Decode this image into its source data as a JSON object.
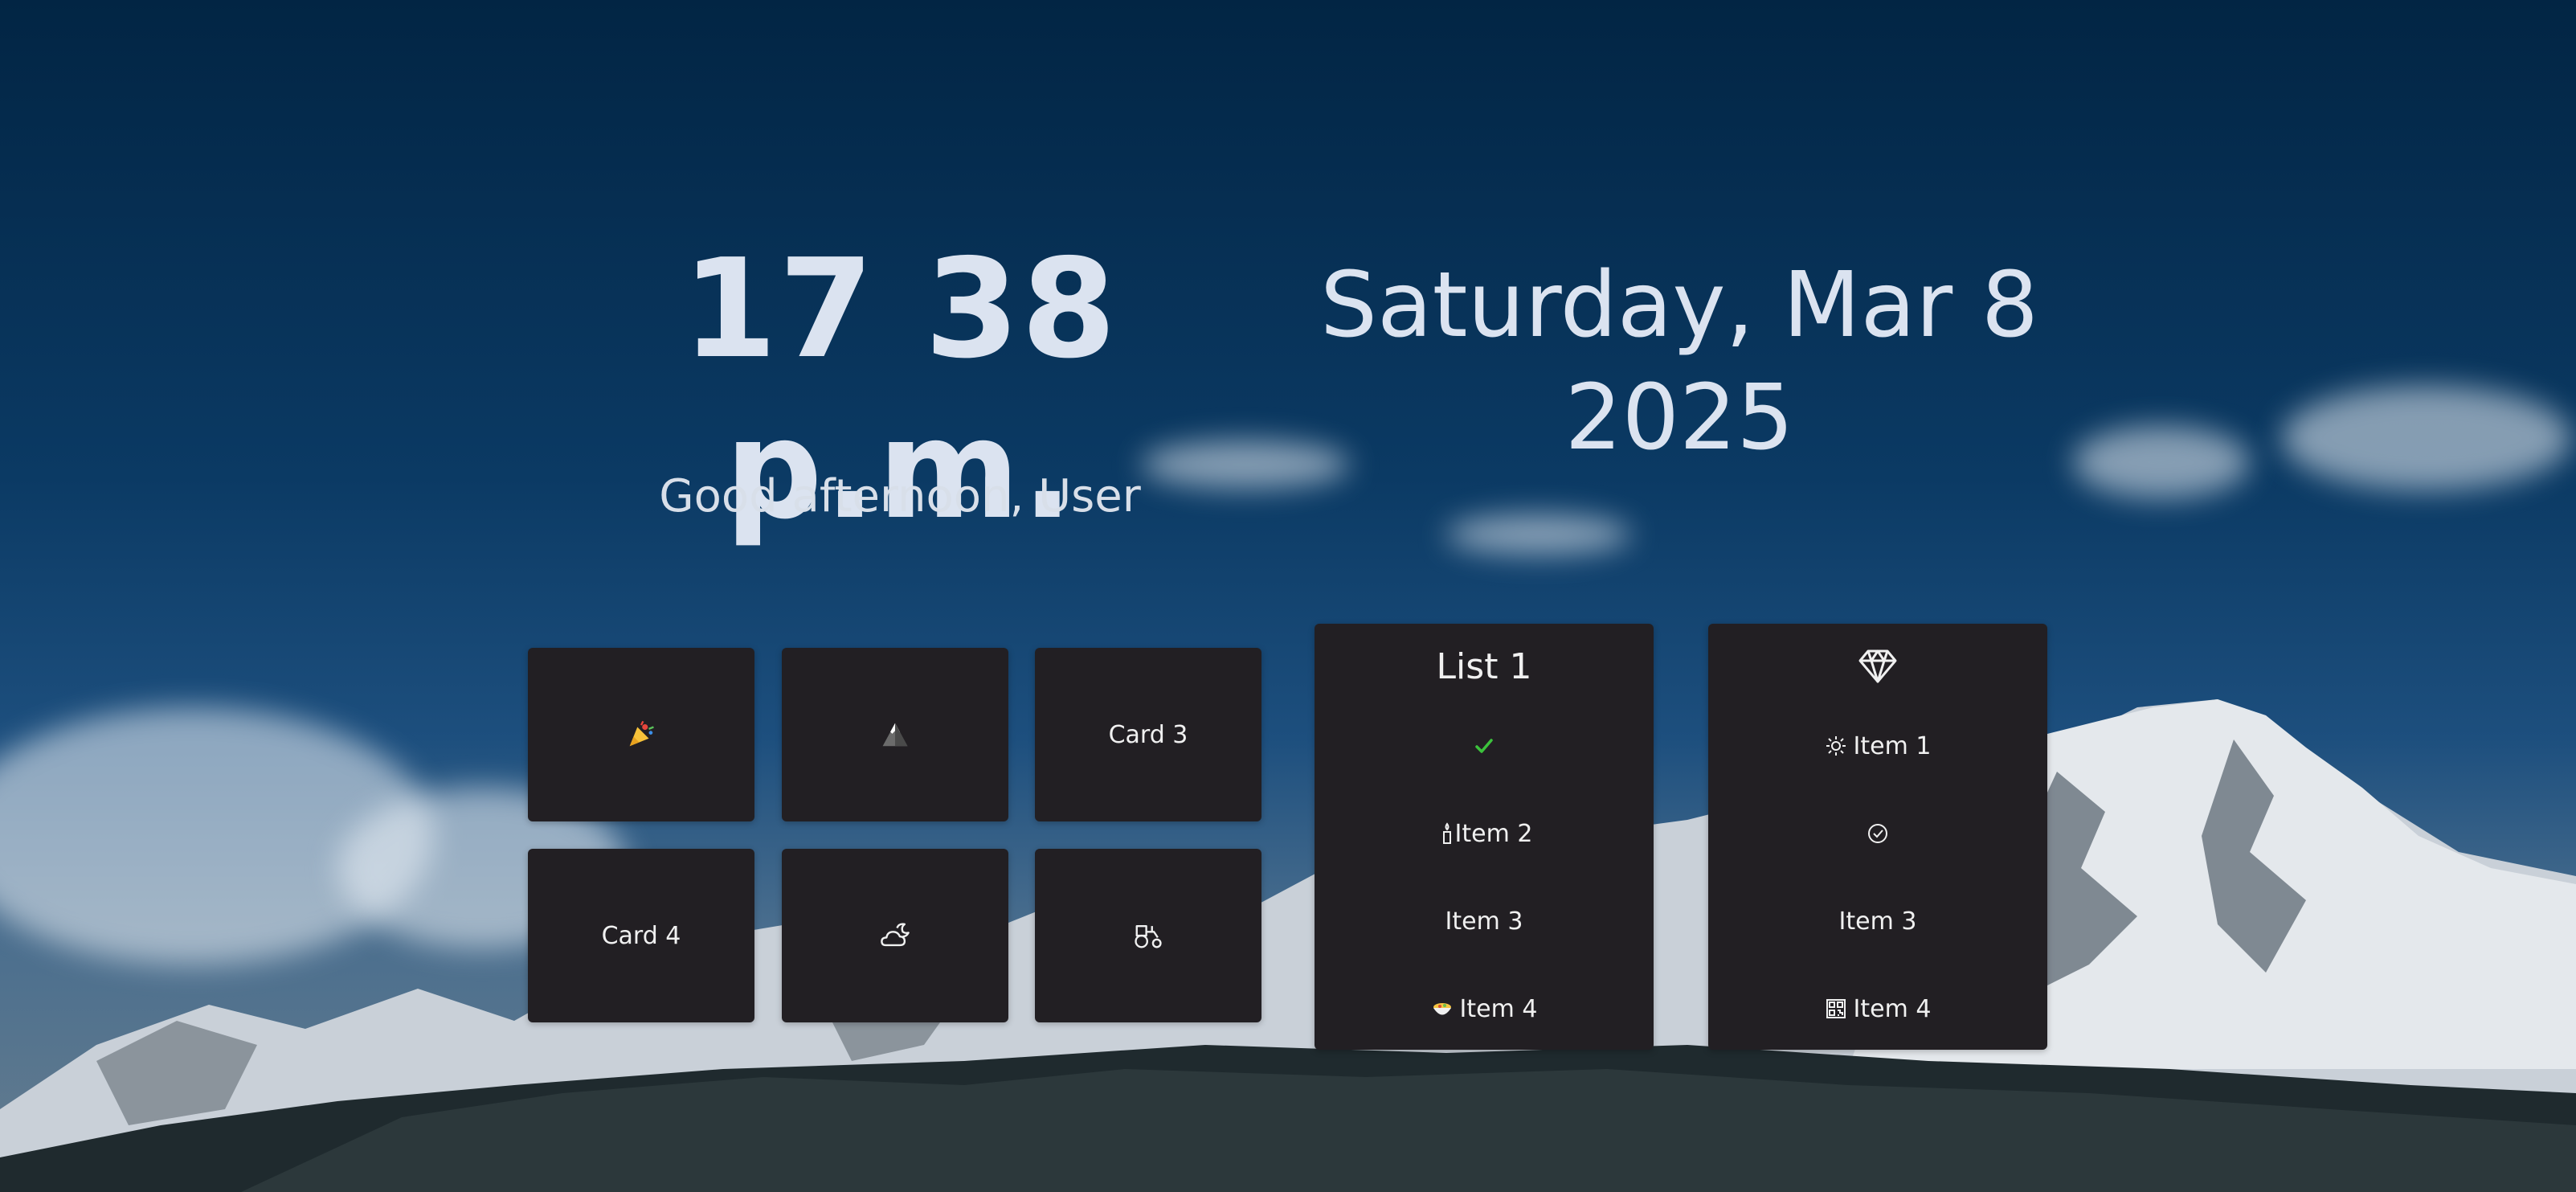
{
  "clock": {
    "time": "17 38 p.m.",
    "date_line1": "Saturday, Mar 8",
    "date_line2": "2025",
    "greeting": "Good afternoon, User"
  },
  "cards": [
    {
      "label": "",
      "icon": "party-popper-icon"
    },
    {
      "label": "",
      "icon": "mountain-icon"
    },
    {
      "label": "Card 3",
      "icon": ""
    },
    {
      "label": "Card 4",
      "icon": ""
    },
    {
      "label": "",
      "icon": "cloud-moon-icon"
    },
    {
      "label": "",
      "icon": "tractor-icon"
    }
  ],
  "list1": {
    "title": "List 1",
    "items": [
      {
        "label": "",
        "icon": "checkmark-icon"
      },
      {
        "label": "Item 2",
        "icon": "candle-icon"
      },
      {
        "label": "Item 3",
        "icon": ""
      },
      {
        "label": "Item 4",
        "icon": "food-bowl-icon"
      }
    ]
  },
  "list2": {
    "header_icon": "diamond-icon",
    "items": [
      {
        "label": "Item 1",
        "icon": "sun-icon"
      },
      {
        "label": "",
        "icon": "check-circle-icon"
      },
      {
        "label": "Item 3",
        "icon": ""
      },
      {
        "label": "Item 4",
        "icon": "qr-code-icon"
      }
    ]
  },
  "colors": {
    "card_bg": "#221f23",
    "text_primary": "#dbe3f0",
    "check_green": "#3cc23c",
    "sky_top": "#022544"
  }
}
